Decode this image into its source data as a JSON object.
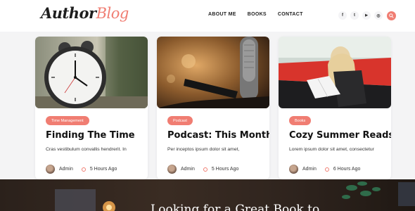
{
  "brand": {
    "part1": "Author",
    "part2": "Blog"
  },
  "nav": {
    "items": [
      "ABOUT ME",
      "BOOKS",
      "CONTACT"
    ]
  },
  "social": {
    "icons": [
      "facebook-icon",
      "twitter-icon",
      "youtube-icon",
      "instagram-icon"
    ],
    "glyphs": [
      "f",
      "t",
      "▶",
      "◎"
    ]
  },
  "accent_color": "#f07d72",
  "cards": [
    {
      "category": "Time Management",
      "title": "Finding The Time",
      "excerpt": "Cras vestibulum convallis hendrerit. In",
      "author": "Admin",
      "time": "5 Hours Ago"
    },
    {
      "category": "Podcast",
      "title": "Podcast: This Month",
      "excerpt": "Per inceptos ipsum dolor sit amet,",
      "author": "Admin",
      "time": "5 Hours Ago"
    },
    {
      "category": "Books",
      "title": "Cozy Summer Reads",
      "excerpt": "Lorem ipsum dolor sit amet, consectetur",
      "author": "Admin",
      "time": "6 Hours Ago"
    }
  ],
  "banner": {
    "title": "Looking for a Great Book to"
  }
}
